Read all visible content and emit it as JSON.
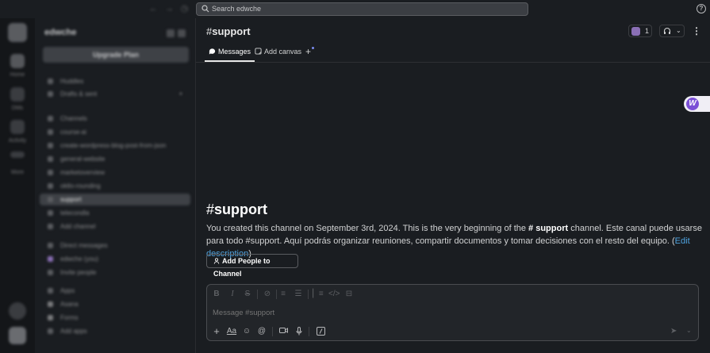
{
  "search": {
    "placeholder": "Search edwche"
  },
  "workspace": {
    "name": "edwche",
    "upgrade_label": "Upgrade Plan"
  },
  "rail": {
    "items": [
      "Home",
      "DMs",
      "Activity",
      "More"
    ]
  },
  "sidebar": {
    "items": [
      {
        "label": "Huddles"
      },
      {
        "label": "Drafts & sent"
      },
      {
        "label": "Channels"
      },
      {
        "label": "course-ai"
      },
      {
        "label": "create-wordpress-blog-post-from-json"
      },
      {
        "label": "general-website"
      },
      {
        "label": "marketoverview"
      },
      {
        "label": "oktlo-rounding"
      },
      {
        "label": "support",
        "selected": true
      },
      {
        "label": "telecondla"
      },
      {
        "label": "Add channel"
      },
      {
        "label": "Direct messages"
      },
      {
        "label": "edwche (you)"
      },
      {
        "label": "Invite people"
      },
      {
        "label": "Apps"
      },
      {
        "label": "Asana"
      },
      {
        "label": "Forms"
      },
      {
        "label": "Add apps"
      }
    ]
  },
  "channel": {
    "hash": "#",
    "name": "support",
    "member_count": "1"
  },
  "tabs": [
    {
      "label": "Messages",
      "active": true
    },
    {
      "label": "Add canvas",
      "active": false
    }
  ],
  "intro": {
    "hash": "#",
    "title": "support",
    "text_part1": "You created this channel on September 3rd, 2024. This is the very beginning of the ",
    "channel_ref": "# support",
    "text_part2": " channel. Este canal puede usarse para todo #support. Aquí podrás organizar reuniones, compartir documentos y tomar decisiones con el resto del equipo. (",
    "edit_link": "Edit description",
    "text_part3": ")",
    "add_people_label": "Add People to Channel"
  },
  "composer": {
    "placeholder": "Message #support",
    "format_icons": [
      "bold-icon",
      "italic-icon",
      "strikethrough-icon",
      "link-icon",
      "ordered-list-icon",
      "bulleted-list-icon",
      "blockquote-icon",
      "code-icon",
      "code-block-icon"
    ],
    "aa_label": "Aa",
    "tools": [
      "plus-icon",
      "format-toggle",
      "emoji-icon",
      "mention-icon",
      "video-icon",
      "microphone-icon",
      "slash-command-icon"
    ]
  },
  "colors": {
    "background": "#1a1d21",
    "link": "#4fa3e0",
    "sidebar_selected": "#3e4146",
    "app_plugin": "#7b4fd6"
  }
}
